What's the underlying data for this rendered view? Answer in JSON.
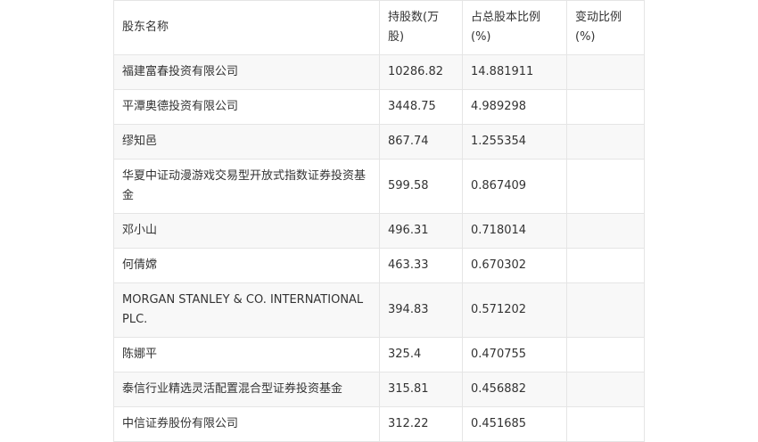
{
  "table": {
    "headers": [
      "股东名称",
      "持股数(万股)",
      "占总股本比例(%)",
      "变动比例(%)"
    ],
    "rows": [
      [
        "福建富春投资有限公司",
        "10286.82",
        "14.881911",
        ""
      ],
      [
        "平潭奥德投资有限公司",
        "3448.75",
        "4.989298",
        ""
      ],
      [
        "缪知邑",
        "867.74",
        "1.255354",
        ""
      ],
      [
        "华夏中证动漫游戏交易型开放式指数证券投资基金",
        "599.58",
        "0.867409",
        ""
      ],
      [
        "邓小山",
        "496.31",
        "0.718014",
        ""
      ],
      [
        "何倩嫦",
        "463.33",
        "0.670302",
        ""
      ],
      [
        "MORGAN STANLEY & CO. INTERNATIONAL PLC.",
        "394.83",
        "0.571202",
        ""
      ],
      [
        "陈娜平",
        "325.4",
        "0.470755",
        ""
      ],
      [
        "泰信行业精选灵活配置混合型证券投资基金",
        "315.81",
        "0.456882",
        ""
      ],
      [
        "中信证券股份有限公司",
        "312.22",
        "0.451685",
        ""
      ]
    ]
  }
}
